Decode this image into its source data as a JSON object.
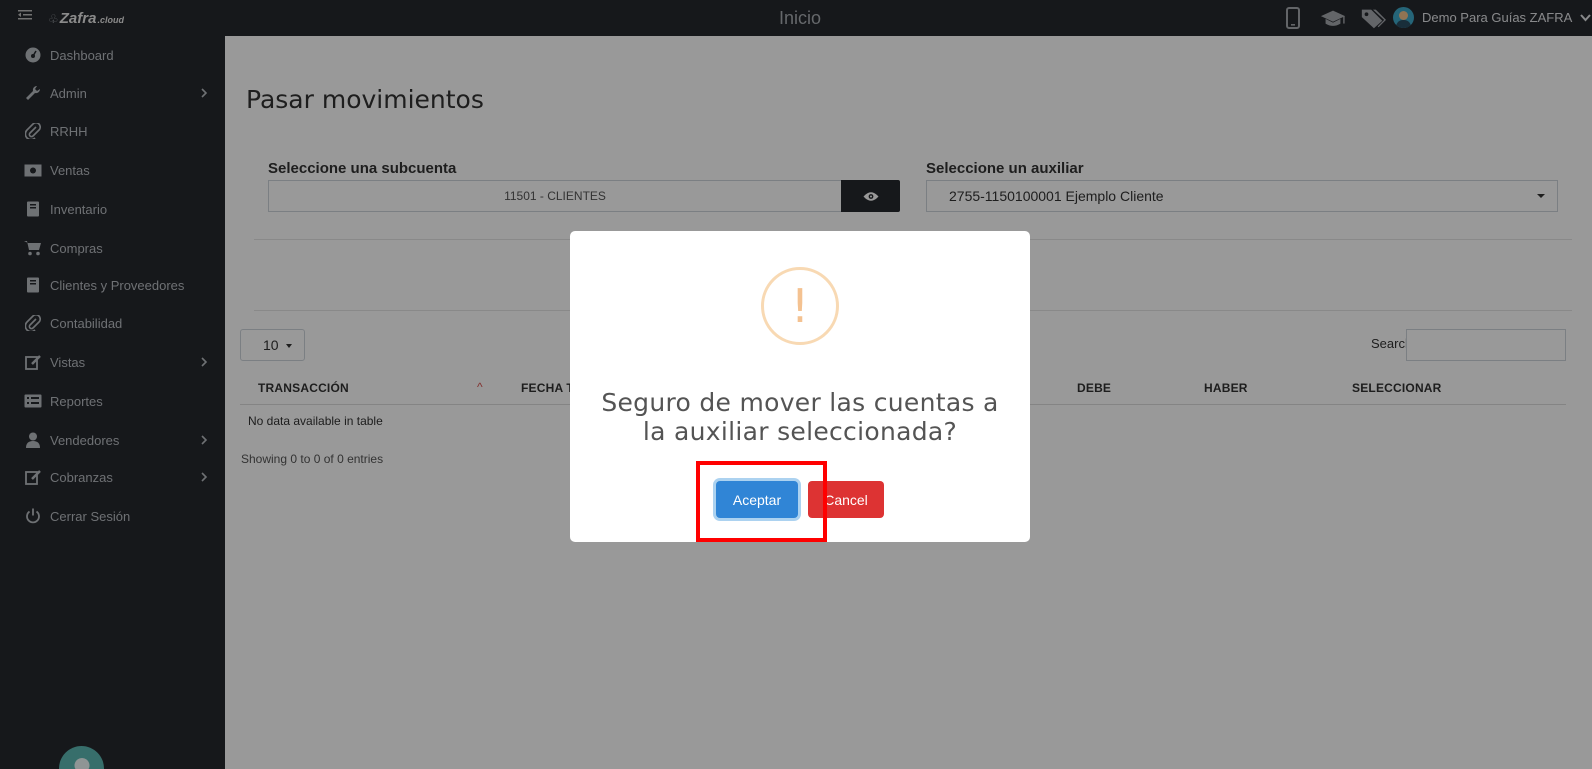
{
  "topbar": {
    "logo_text": "Zafra",
    "logo_suffix": ".cloud",
    "page_heading": "Inicio",
    "icons": [
      "mobile-icon",
      "graduation-cap-icon",
      "tags-icon"
    ],
    "user_name": "Demo Para Guías ZAFRA"
  },
  "sidebar": {
    "items": [
      {
        "label": "Dashboard",
        "icon": "dashboard-icon",
        "has_chevron": false
      },
      {
        "label": "Admin",
        "icon": "wrench-icon",
        "has_chevron": true
      },
      {
        "label": "RRHH",
        "icon": "paperclip-icon",
        "has_chevron": false
      },
      {
        "label": "Ventas",
        "icon": "money-icon",
        "has_chevron": false
      },
      {
        "label": "Inventario",
        "icon": "book-icon",
        "has_chevron": false
      },
      {
        "label": "Compras",
        "icon": "cart-icon",
        "has_chevron": false
      },
      {
        "label": "Clientes y Proveedores",
        "icon": "book-icon",
        "has_chevron": false
      },
      {
        "label": "Contabilidad",
        "icon": "paperclip-icon",
        "has_chevron": false
      },
      {
        "label": "Vistas",
        "icon": "edit-icon",
        "has_chevron": true
      },
      {
        "label": "Reportes",
        "icon": "list-icon",
        "has_chevron": false
      },
      {
        "label": "Vendedores",
        "icon": "user-icon",
        "has_chevron": true
      },
      {
        "label": "Cobranzas",
        "icon": "edit-icon",
        "has_chevron": true
      },
      {
        "label": "Cerrar Sesión",
        "icon": "power-icon",
        "has_chevron": false
      }
    ]
  },
  "main": {
    "title": "Pasar movimientos",
    "subcuenta_label": "Seleccione una subcuenta",
    "subcuenta_value": "11501 - CLIENTES",
    "auxiliar_label": "Seleccione un auxiliar",
    "auxiliar_value": "2755-1150100001 Ejemplo Cliente",
    "page_length": "10",
    "search_label": "Search:",
    "columns": [
      "TRANSACCIÓN",
      "FECHA T",
      "DEBE",
      "HABER",
      "SELECCIONAR"
    ],
    "empty_message": "No data available in table",
    "info": "Showing 0 to 0 of 0 entries"
  },
  "dialog": {
    "icon": "warning-icon",
    "message": "Seguro de mover las cuentas a la auxiliar seleccionada?",
    "accept_label": "Aceptar",
    "cancel_label": "Cancel",
    "highlight_color": "#ff0000"
  },
  "colors": {
    "sidebar_bg": "#26282d",
    "accept": "#3085d6",
    "cancel": "#dd3333",
    "help_bubble": "#5cb7b2"
  }
}
